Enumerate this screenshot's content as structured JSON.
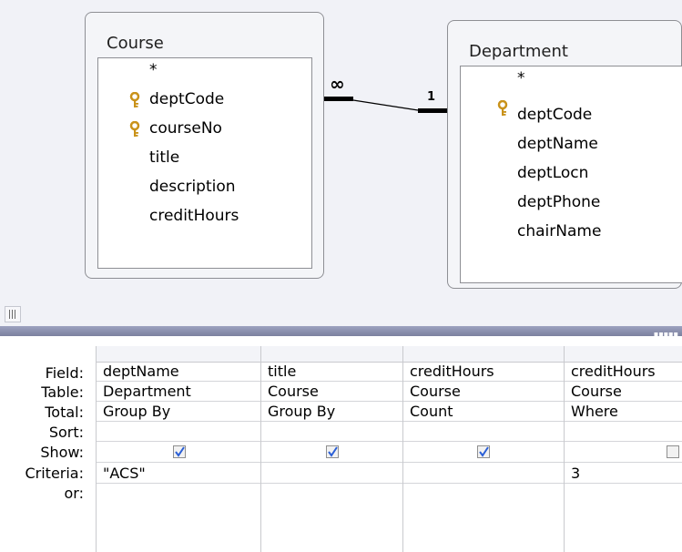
{
  "query_designer": {
    "tables": [
      {
        "name": "Course",
        "fields": [
          {
            "label": "*",
            "key": false
          },
          {
            "label": "deptCode",
            "key": true
          },
          {
            "label": "courseNo",
            "key": true
          },
          {
            "label": "title",
            "key": false
          },
          {
            "label": "description",
            "key": false
          },
          {
            "label": "creditHours",
            "key": false
          }
        ]
      },
      {
        "name": "Department",
        "fields": [
          {
            "label": "*",
            "key": false
          },
          {
            "label": "deptCode",
            "key": true
          },
          {
            "label": "deptName",
            "key": false
          },
          {
            "label": "deptLocn",
            "key": false
          },
          {
            "label": "deptPhone",
            "key": false
          },
          {
            "label": "chairName",
            "key": false
          }
        ]
      }
    ],
    "relationship": {
      "many_symbol": "∞",
      "one_symbol": "1"
    },
    "colors": {
      "key_icon": "#d6a21c",
      "splitter": "#8a8fab",
      "background": "#f1f2f7"
    }
  },
  "grid": {
    "row_labels": [
      "Field:",
      "Table:",
      "Total:",
      "Sort:",
      "Show:",
      "Criteria:",
      "or:"
    ],
    "columns": [
      {
        "field": "deptName",
        "table": "Department",
        "total": "Group By",
        "sort": "",
        "show": true,
        "criteria": "\"ACS\"",
        "or": ""
      },
      {
        "field": "title",
        "table": "Course",
        "total": "Group By",
        "sort": "",
        "show": true,
        "criteria": "",
        "or": ""
      },
      {
        "field": "creditHours",
        "table": "Course",
        "total": "Count",
        "sort": "",
        "show": true,
        "criteria": "",
        "or": ""
      },
      {
        "field": "creditHours",
        "table": "Course",
        "total": "Where",
        "sort": "",
        "show": false,
        "criteria": "3",
        "or": ""
      }
    ]
  }
}
